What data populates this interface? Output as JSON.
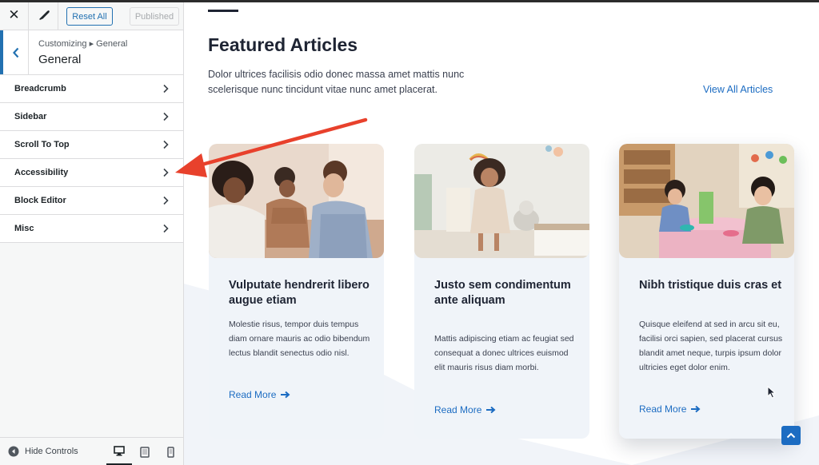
{
  "sidebar": {
    "reset_label": "Reset All",
    "published_label": "Published",
    "breadcrumb": "Customizing ▸ General",
    "section_title": "General",
    "items": [
      {
        "label": "Breadcrumb"
      },
      {
        "label": "Sidebar"
      },
      {
        "label": "Scroll To Top"
      },
      {
        "label": "Accessibility"
      },
      {
        "label": "Block Editor"
      },
      {
        "label": "Misc"
      }
    ],
    "hide_controls_label": "Hide Controls",
    "active_device": "desktop"
  },
  "preview": {
    "title": "Featured Articles",
    "description": "Dolor ultrices facilisis odio donec massa amet mattis nunc scelerisque nunc tincidunt vitae nunc amet placerat.",
    "view_all": "View All Articles",
    "cards": [
      {
        "title": "Vulputate hendrerit libero augue etiam",
        "text": "Molestie risus, tempor duis tempus diam ornare mauris ac odio bibendum lectus blandit senectus odio nisl.",
        "link": "Read More",
        "image": "family-photo"
      },
      {
        "title": "Justo sem condimentum ante aliquam",
        "text": "Mattis adipiscing etiam ac feugiat sed consequat a donec ultrices euismod elit mauris risus diam morbi.",
        "link": "Read More",
        "image": "child-dancing-photo"
      },
      {
        "title": "Nibh tristique duis cras et",
        "text": "Quisque eleifend at sed in arcu sit eu, facilisi orci sapien, sed placerat cursus blandit amet neque, turpis ipsum dolor ultricies eget dolor enim.",
        "link": "Read More",
        "image": "classroom-photo"
      }
    ]
  },
  "colors": {
    "accent": "#1c6cc2",
    "wp_blue": "#2271b1",
    "annotation_arrow": "#e8412c",
    "card_bg": "#f0f4f9"
  }
}
